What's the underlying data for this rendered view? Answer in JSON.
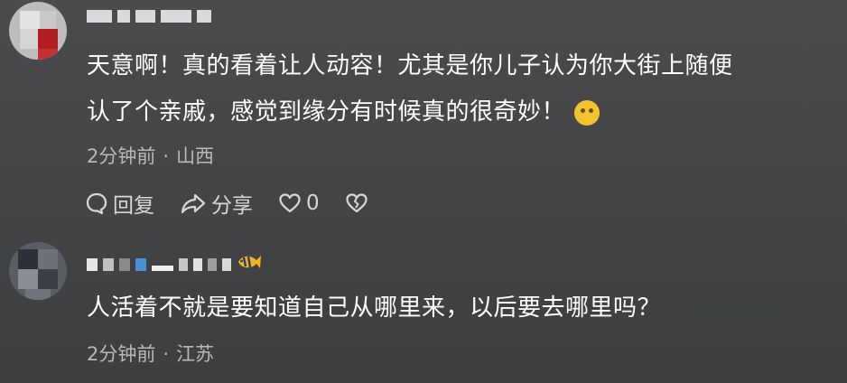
{
  "comments": [
    {
      "username": "",
      "text_line1": "天意啊！真的看着让人动容！尤其是你儿子认为你大街上随便",
      "text_line2": "认了个亲戚，感觉到缘分有时候真的很奇妙！",
      "emoji": "thinking-face",
      "time": "2分钟前",
      "separator": "·",
      "location": "山西",
      "actions": {
        "reply": "回复",
        "share": "分享",
        "like_count": "0"
      }
    },
    {
      "username": "",
      "text_line1": "人活着不就是要知道自己从哪里来，以后要去哪里吗？",
      "time": "2分钟前",
      "separator": "·",
      "location": "江苏"
    }
  ],
  "colors": {
    "background": "#444547",
    "text": "#ffffff",
    "meta": "#b9b9bb",
    "actions": "#d7d7d8"
  }
}
